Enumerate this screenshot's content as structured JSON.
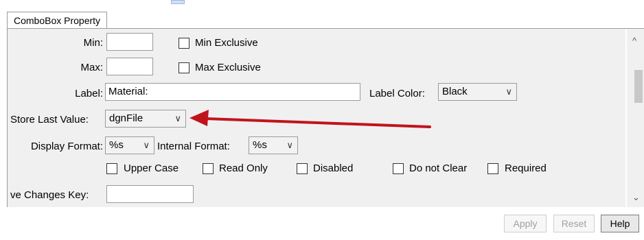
{
  "tab": {
    "label": "ComboBox Property"
  },
  "rows": {
    "min": {
      "label": "Min:",
      "value": "",
      "exclusive_label": "Min Exclusive"
    },
    "max": {
      "label": "Max:",
      "value": "",
      "exclusive_label": "Max Exclusive"
    },
    "label": {
      "label": "Label:",
      "value": "Material:",
      "color_label": "Label Color:",
      "color_value": "Black"
    },
    "store_last_value": {
      "label": "Store Last Value:",
      "value": "dgnFile"
    },
    "display_format": {
      "label": "Display Format:",
      "value": "%s"
    },
    "internal_format": {
      "label": "Internal Format:",
      "value": "%s"
    },
    "checkboxes": {
      "upper_case": "Upper Case",
      "read_only": "Read Only",
      "disabled": "Disabled",
      "do_not_clear": "Do not Clear",
      "required": "Required"
    },
    "save_changes_key": {
      "label": "ve Changes Key:",
      "value": ""
    }
  },
  "buttons": {
    "apply": "Apply",
    "reset": "Reset",
    "help": "Help"
  },
  "icons": {
    "dropdown": "chevron-down-icon",
    "scroll_up": "chevron-up-icon",
    "scroll_down": "chevron-down-icon",
    "annotation": "red-arrow-icon"
  },
  "colors": {
    "annotation_arrow": "#c0141c",
    "panel_bg": "#f0f0f0"
  }
}
